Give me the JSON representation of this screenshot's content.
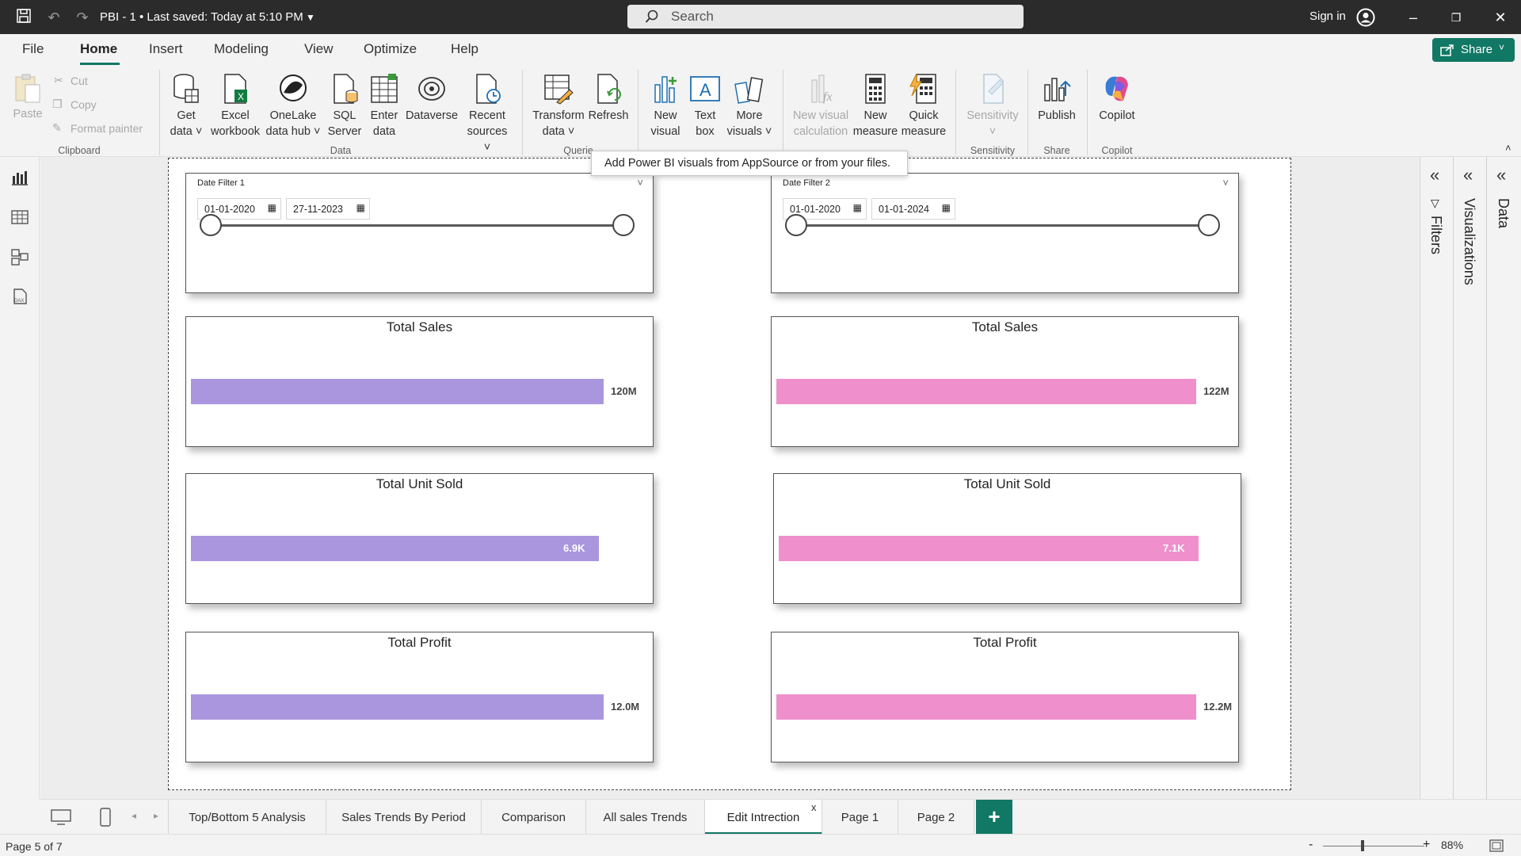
{
  "titlebar": {
    "doc_title": "PBI - 1  •  Last saved: Today at 5:10 PM",
    "search_placeholder": "Search",
    "sign_in": "Sign in"
  },
  "menu": {
    "items": [
      "File",
      "Home",
      "Insert",
      "Modeling",
      "View",
      "Optimize",
      "Help"
    ],
    "active": "Home",
    "share": "Share"
  },
  "ribbon": {
    "clipboard": {
      "paste": "Paste",
      "cut": "Cut",
      "copy": "Copy",
      "format_painter": "Format painter",
      "group": "Clipboard"
    },
    "data": {
      "get_data": [
        "Get",
        "data ˅"
      ],
      "excel": [
        "Excel",
        "workbook"
      ],
      "onelake": [
        "OneLake",
        "data hub ˅"
      ],
      "sql": [
        "SQL",
        "Server"
      ],
      "enter": [
        "Enter",
        "data"
      ],
      "dataverse": "Dataverse",
      "recent": [
        "Recent",
        "sources ˅"
      ],
      "group": "Data"
    },
    "queries": {
      "transform": [
        "Transform",
        "data ˅"
      ],
      "refresh": "Refresh",
      "group": "Querie"
    },
    "insert": {
      "new_visual": [
        "New",
        "visual"
      ],
      "text_box": [
        "Text",
        "box"
      ],
      "more_visuals": [
        "More",
        "visuals ˅"
      ]
    },
    "calculations": {
      "new_visual_calc": [
        "New visual",
        "calculation"
      ],
      "new_measure": [
        "New",
        "measure"
      ],
      "quick_measure": [
        "Quick",
        "measure"
      ]
    },
    "sensitivity": {
      "label": "Sensitivity",
      "group": "Sensitivity"
    },
    "share": {
      "publish": "Publish",
      "group": "Share"
    },
    "copilot": {
      "label": "Copilot",
      "group": "Copilot"
    }
  },
  "tooltip": "Add Power BI visuals from AppSource or from your files.",
  "slicers": [
    {
      "title": "Date Filter 1",
      "start": "01-01-2020",
      "end": "27-11-2023"
    },
    {
      "title": "Date Filter 2",
      "start": "01-01-2020",
      "end": "01-01-2024"
    }
  ],
  "cards": [
    {
      "title": "Total Sales",
      "left_value": "120M",
      "right_value": "122M"
    },
    {
      "title": "Total Unit Sold",
      "left_value": "6.9K",
      "right_value": "7.1K"
    },
    {
      "title": "Total Profit",
      "left_value": "12.0M",
      "right_value": "12.2M"
    }
  ],
  "colors": {
    "left_bar": "#aa96de",
    "right_bar": "#ef90cc",
    "accent": "#117865"
  },
  "chart_data": [
    {
      "type": "bar",
      "title": "Total Sales",
      "categories": [
        "Date Filter 1",
        "Date Filter 2"
      ],
      "values": [
        120000000,
        122000000
      ]
    },
    {
      "type": "bar",
      "title": "Total Unit Sold",
      "categories": [
        "Date Filter 1",
        "Date Filter 2"
      ],
      "values": [
        6900,
        7100
      ]
    },
    {
      "type": "bar",
      "title": "Total Profit",
      "categories": [
        "Date Filter 1",
        "Date Filter 2"
      ],
      "values": [
        12000000,
        12200000
      ]
    }
  ],
  "panes": {
    "filters": "Filters",
    "visualizations": "Visualizations",
    "data": "Data"
  },
  "tabs": [
    "Top/Bottom 5 Analysis",
    "Sales Trends By Period",
    "Comparison",
    "All sales Trends",
    "Edit Intrection",
    "Page 1",
    "Page 2"
  ],
  "active_tab": "Edit Intrection",
  "status": {
    "page": "Page 5 of 7",
    "zoom": "88%"
  }
}
